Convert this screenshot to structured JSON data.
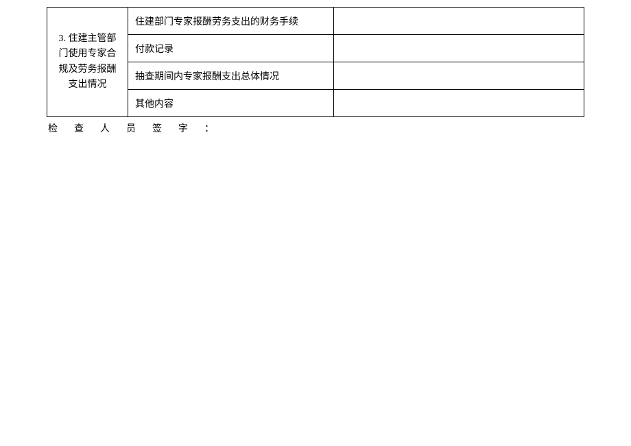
{
  "table": {
    "section_label": "3. 住建主管部门使用专家合规及劳务报酬支出情况",
    "rows": [
      {
        "item": "住建部门专家报酬劳务支出的财务手续",
        "value": ""
      },
      {
        "item": "付款记录",
        "value": ""
      },
      {
        "item": "抽查期间内专家报酬支出总体情况",
        "value": ""
      },
      {
        "item": "其他内容",
        "value": ""
      }
    ]
  },
  "footer": {
    "signature_label": "检查人员签字："
  }
}
